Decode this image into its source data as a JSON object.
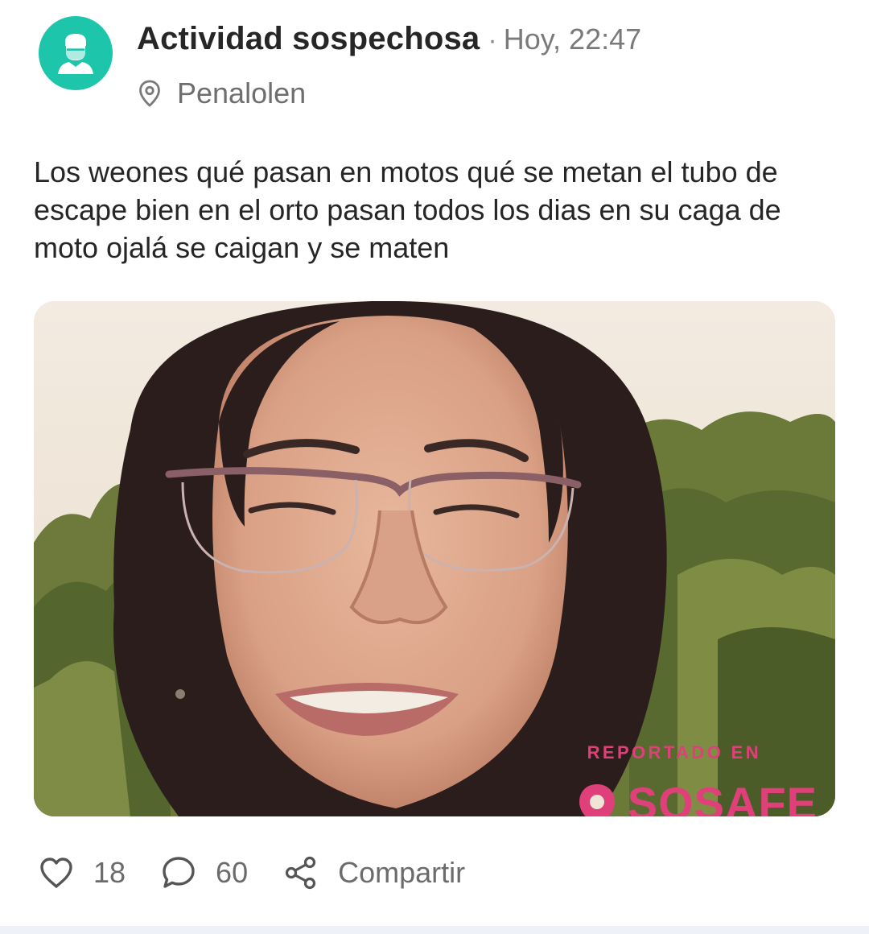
{
  "post": {
    "category": "Actividad sospechosa",
    "separator": "·",
    "time": "Hoy, 22:47",
    "location": "Penalolen",
    "text": "Los weones qué pasan en motos qué se metan el tubo de escape bien en el orto pasan todos los dias en su caga de moto ojalá se caigan y se maten",
    "avatar_icon": "masked-person-icon",
    "avatar_color": "#1dc5aa"
  },
  "photo": {
    "watermark_label": "REPORTADO EN",
    "watermark_brand": "SOSAFE",
    "watermark_color": "#e0407a"
  },
  "actions": {
    "likes": "18",
    "comments": "60",
    "share_label": "Compartir",
    "like_icon": "heart-icon",
    "comment_icon": "speech-bubble-icon",
    "share_icon": "share-icon"
  }
}
